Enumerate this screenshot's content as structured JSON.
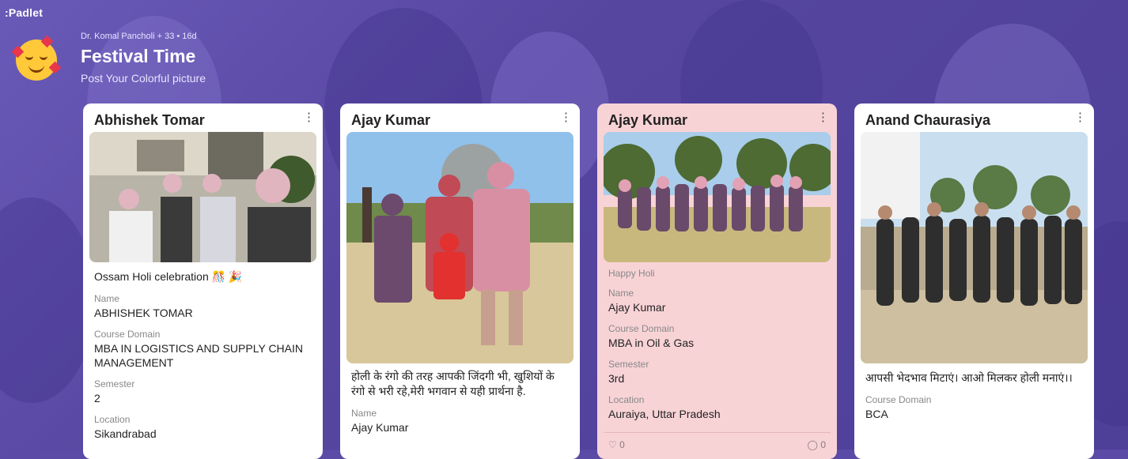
{
  "app": {
    "logo": ":Padlet"
  },
  "board": {
    "meta": "Dr. Komal Pancholi + 33 • 16d",
    "title": "Festival Time",
    "subtitle": "Post Your Colorful picture"
  },
  "cards": [
    {
      "author": "Abhishek Tomar",
      "description": "Ossam Holi celebration 🎊 🎉",
      "fields": [
        {
          "label": "Name",
          "value": "ABHISHEK TOMAR"
        },
        {
          "label": "Course Domain",
          "value": "MBA IN LOGISTICS AND SUPPLY CHAIN MANAGEMENT"
        },
        {
          "label": "Semester",
          "value": "2"
        },
        {
          "label": "Location",
          "value": "Sikandrabad"
        }
      ]
    },
    {
      "author": "Ajay Kumar",
      "description": "होली के रंगो की तरह आपकी जिंदगी भी, खुशियों के रंगो से भरी रहे,मेरी भगवान से यही प्रार्थना है.",
      "fields": [
        {
          "label": "Name",
          "value": "Ajay Kumar"
        }
      ]
    },
    {
      "author": "Ajay Kumar",
      "description": "Happy Holi",
      "fields": [
        {
          "label": "Name",
          "value": "Ajay Kumar"
        },
        {
          "label": "Course Domain",
          "value": "MBA in Oil & Gas"
        },
        {
          "label": "Semester",
          "value": "3rd"
        },
        {
          "label": "Location",
          "value": "Auraiya, Uttar Pradesh"
        }
      ],
      "likes": "0",
      "comments": "0"
    },
    {
      "author": "Anand Chaurasiya",
      "description": "आपसी भेदभाव मिटाएं। आओ मिलकर होली मनाएं।।",
      "fields": [
        {
          "label": "Course Domain",
          "value": "BCA"
        }
      ]
    }
  ],
  "icons": {
    "more": "more-vertical-icon",
    "like": "heart-icon",
    "comment": "comment-icon"
  },
  "colors": {
    "background": "#5b4aa6",
    "pink_card": "#f8d3d6",
    "card": "#ffffff"
  }
}
